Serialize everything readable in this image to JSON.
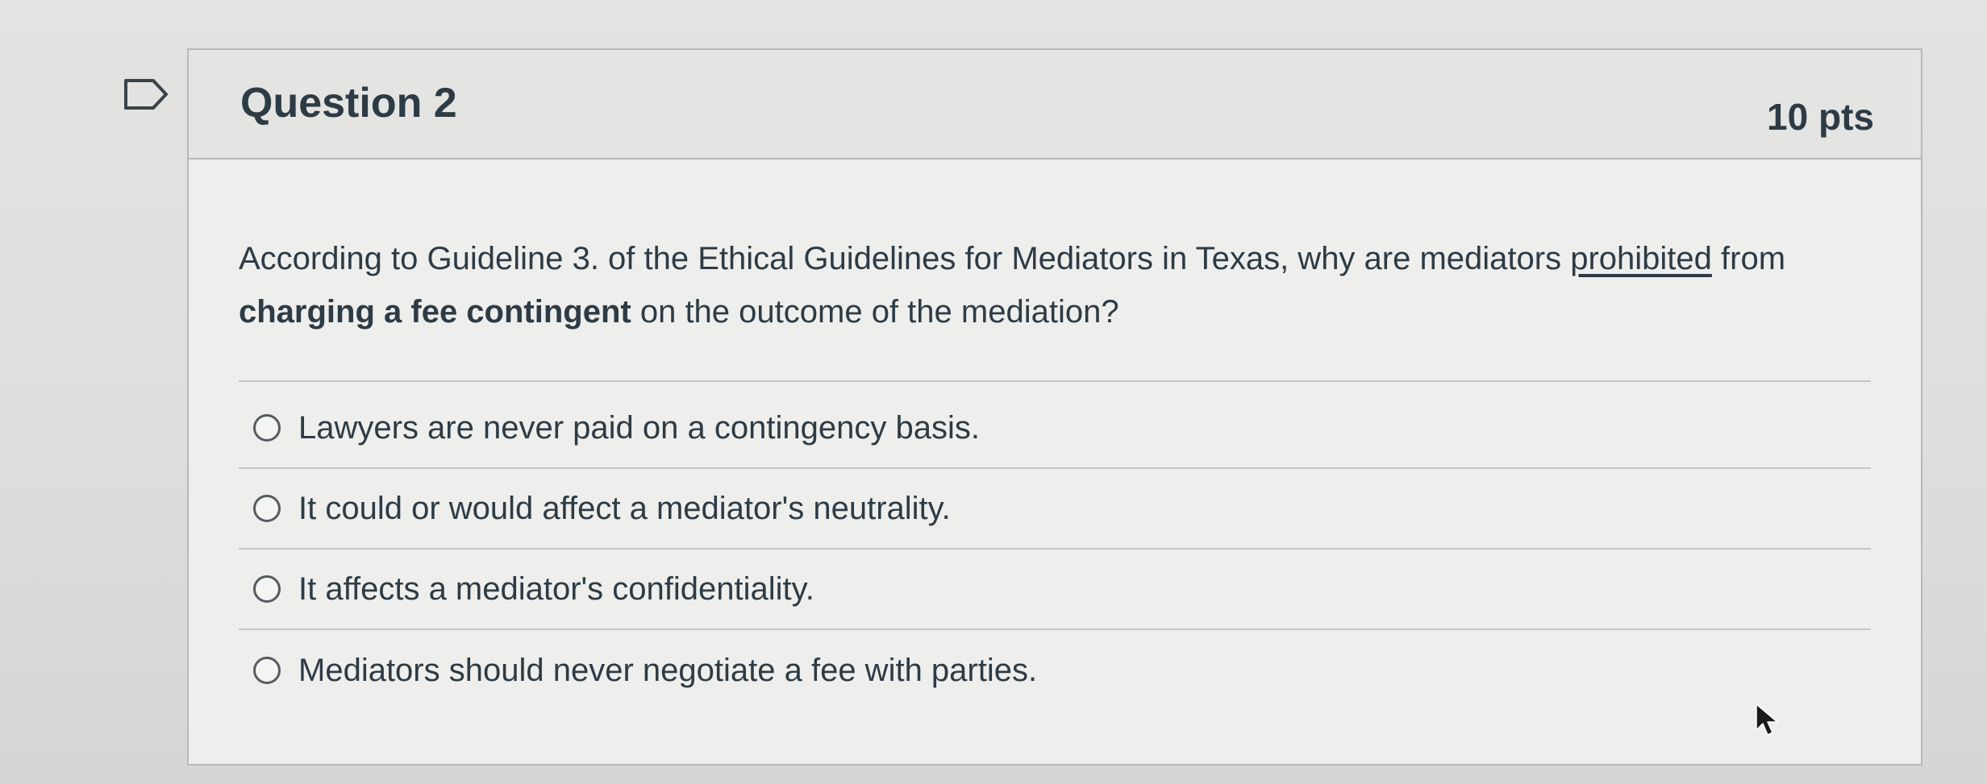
{
  "question": {
    "title": "Question 2",
    "points": "10 pts",
    "text_parts": {
      "p1": "According to Guideline 3. of the Ethical Guidelines for Mediators in Texas, why are mediators ",
      "p2_underlined": "prohibited",
      "p3": " from ",
      "p4_bold": "charging a fee contingent",
      "p5": " on the outcome of the mediation?"
    }
  },
  "answers": [
    {
      "label": "Lawyers are never paid on a contingency basis.",
      "selected": false
    },
    {
      "label": "It could or would affect a mediator's neutrality.",
      "selected": false
    },
    {
      "label": "It affects a mediator's confidentiality.",
      "selected": false
    },
    {
      "label": "Mediators should never negotiate a fee with parties.",
      "selected": false
    }
  ],
  "icons": {
    "flag": "flag-question-icon",
    "cursor": "mouse-cursor-icon"
  },
  "colors": {
    "text": "#2d3b45",
    "border": "#b8b8b6",
    "background": "#eeeeec"
  }
}
